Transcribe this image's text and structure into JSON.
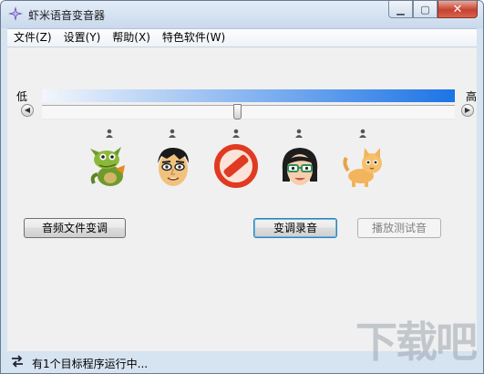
{
  "window": {
    "title": "虾米语音变音器"
  },
  "menubar": [
    {
      "label": "文件(Z)"
    },
    {
      "label": "设置(Y)"
    },
    {
      "label": "帮助(X)"
    },
    {
      "label": "特色软件(W)"
    }
  ],
  "pitch": {
    "low_label": "低",
    "high_label": "高",
    "level": 0.5
  },
  "voices": [
    {
      "icon": "dragon-icon"
    },
    {
      "icon": "man-face-icon"
    },
    {
      "icon": "no-change-icon"
    },
    {
      "icon": "woman-face-icon"
    },
    {
      "icon": "cat-icon"
    }
  ],
  "buttons": {
    "file_convert": "音频文件变调",
    "record": "变调录音",
    "play_test": "播放测试音"
  },
  "status": {
    "text": "有1个目标程序运行中..."
  },
  "watermark": "下载吧",
  "colors": {
    "gradient_start": "#f3f6fb",
    "gradient_end": "#1c74e6",
    "no_icon_red": "#e03a22"
  }
}
